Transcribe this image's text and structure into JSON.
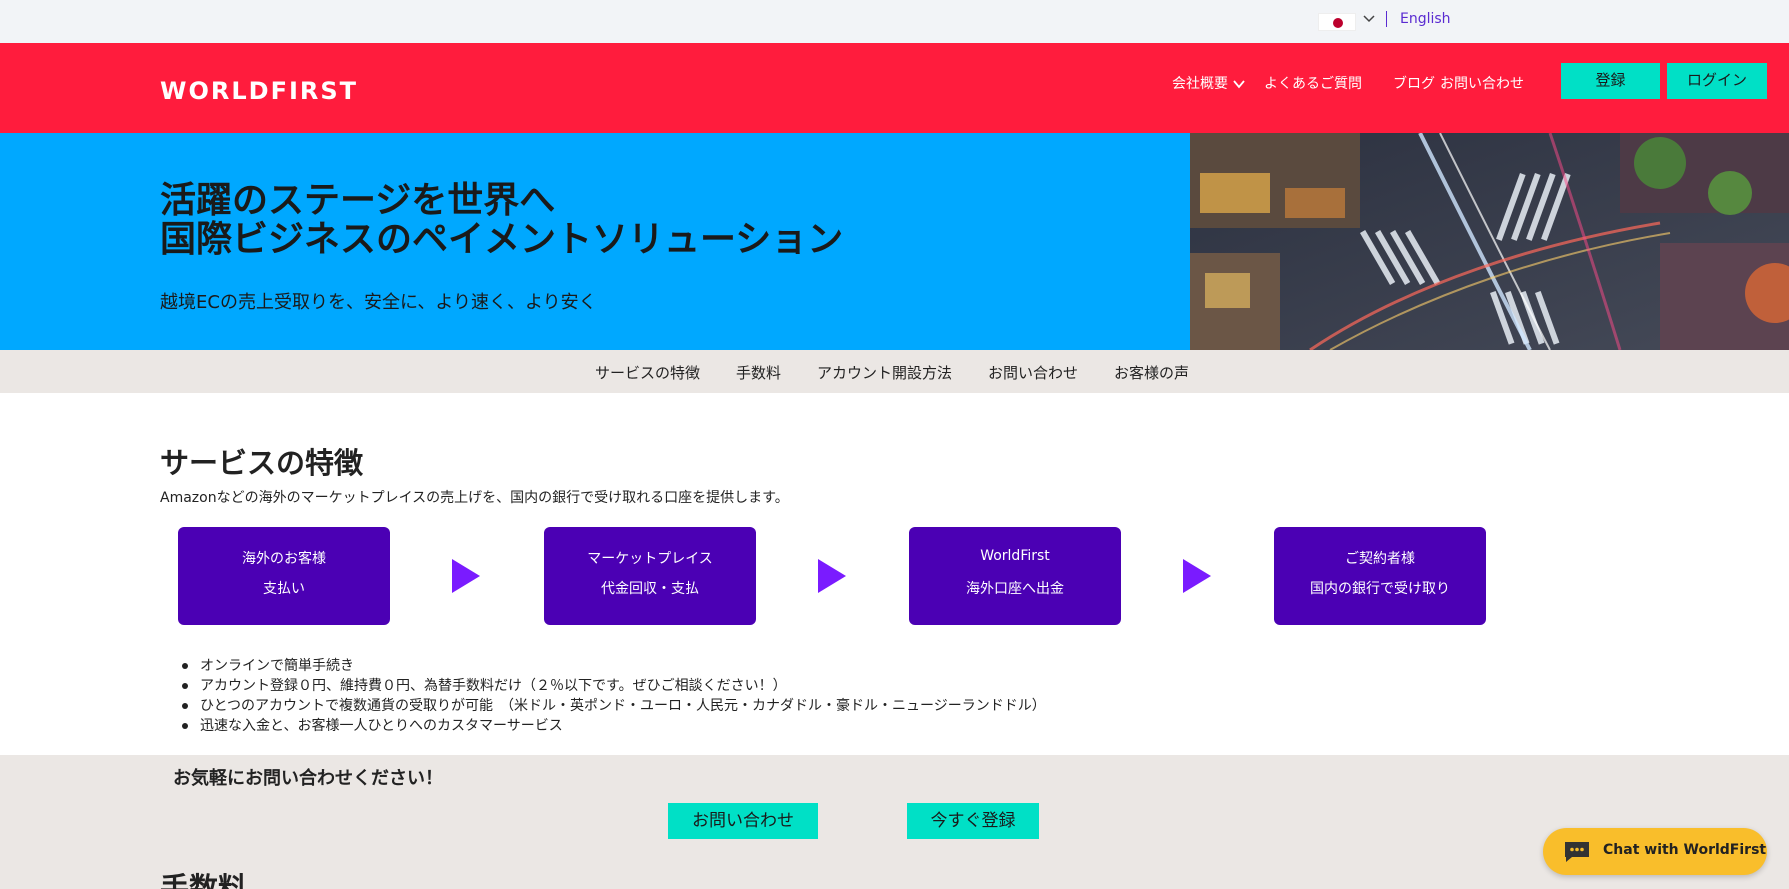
{
  "topbar": {
    "language_label": "English"
  },
  "header": {
    "logo": "WORLDFIRST",
    "nav": {
      "company": "会社概要",
      "faq": "よくあるご質問",
      "blog": "ブログ",
      "contact": "お問い合わせ"
    },
    "register_button": "登録",
    "login_button": "ログイン"
  },
  "hero": {
    "title_line1": "活躍のステージを世界へ",
    "title_line2": "国際ビジネスのペイメントソリューション",
    "subtitle": "越境ECの売上受取りを、安全に、より速く、より安く"
  },
  "subnav": {
    "items": [
      "サービスの特徴",
      "手数料",
      "アカウント開設方法",
      "お問い合わせ",
      "お客様の声"
    ]
  },
  "features": {
    "title": "サービスの特徴",
    "description": "Amazonなどの海外のマーケットプレイスの売上げを、国内の銀行で受け取れる口座を提供します。",
    "flow": [
      {
        "line1": "海外のお客様",
        "line2": "支払い"
      },
      {
        "line1": "マーケットプレイス",
        "line2": "代金回収・支払"
      },
      {
        "line1": "WorldFirst",
        "line2": "海外口座へ出金"
      },
      {
        "line1": "ご契約者様",
        "line2": "国内の銀行で受け取り"
      }
    ],
    "bullets": [
      "オンラインで簡単手続き",
      "アカウント登録０円、維持費０円、為替手数料だけ（２％以下です。ぜひご相談ください！）",
      "ひとつのアカウントで複数通貨の受取りが可能　（米ドル・英ポンド・ユーロ・人民元・カナダドル・豪ドル・ニュージーランドドル）",
      "迅速な入金と、お客様一人ひとりへのカスタマーサービス"
    ]
  },
  "cta": {
    "title": "お気軽にお問い合わせください！",
    "contact_button": "お問い合わせ",
    "register_button": "今すぐ登録"
  },
  "fees": {
    "title": "手数料"
  },
  "chat": {
    "label": "Chat with WorldFirst"
  },
  "colors": {
    "header_bg": "#ff1c3d",
    "hero_bg": "#00a8ff",
    "accent_teal": "#00e0c6",
    "flow_purple": "#4b00b4",
    "arrow_purple": "#7a1bff",
    "chat_yellow": "#f9be2b",
    "link_purple": "#5a2bd1"
  },
  "icons": {
    "flag": "japan-flag-icon",
    "language_dropdown": "chevron-down-icon",
    "company_dropdown": "chevron-down-icon",
    "flow_arrow": "play-arrow-icon",
    "chat": "chat-bubble-icon"
  }
}
